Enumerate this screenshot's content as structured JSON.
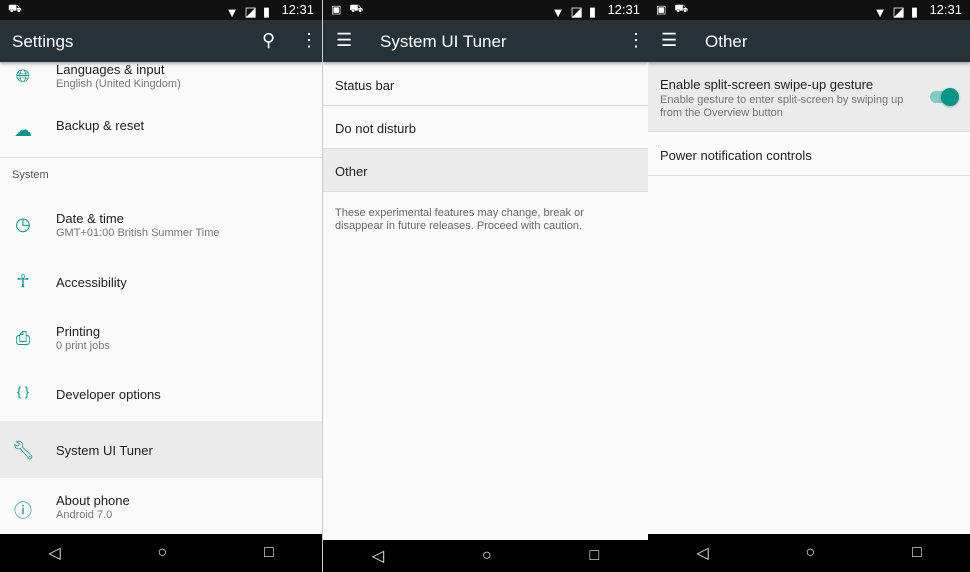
{
  "status": {
    "time": "12:31"
  },
  "settings": {
    "title": "Settings",
    "items": [
      {
        "title": "Languages & input",
        "sub": "English (United Kingdom)"
      },
      {
        "title": "Backup & reset"
      }
    ],
    "section": "System",
    "system_items": [
      {
        "title": "Date & time",
        "sub": "GMT+01:00 British Summer Time"
      },
      {
        "title": "Accessibility"
      },
      {
        "title": "Printing",
        "sub": "0 print jobs"
      },
      {
        "title": "Developer options"
      },
      {
        "title": "System UI Tuner"
      },
      {
        "title": "About phone",
        "sub": "Android 7.0"
      }
    ]
  },
  "tuner": {
    "title": "System UI Tuner",
    "items": [
      "Status bar",
      "Do not disturb",
      "Other"
    ],
    "note": "These experimental features may change, break or disappear in future releases. Proceed with caution."
  },
  "other": {
    "title": "Other",
    "split": {
      "title": "Enable split-screen swipe-up gesture",
      "sub": "Enable gesture to enter split-screen by swiping up from the Overview button",
      "enabled": true
    },
    "power": "Power notification controls"
  },
  "colors": {
    "accent": "#009688",
    "toolbar": "#263238"
  }
}
